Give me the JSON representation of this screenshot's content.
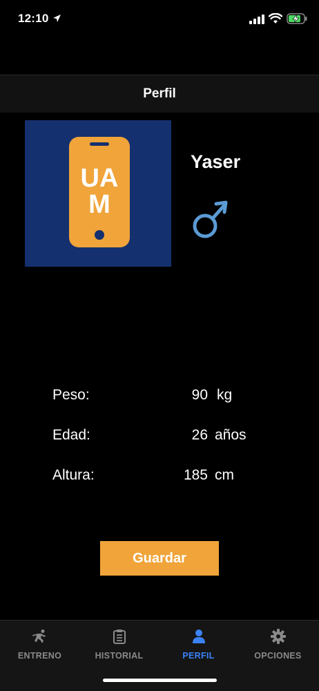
{
  "status_bar": {
    "time": "12:10"
  },
  "nav": {
    "title": "Perfil"
  },
  "profile": {
    "logo_text_top": "UA",
    "logo_text_bottom": "M",
    "name": "Yaser",
    "gender_symbol": "♂"
  },
  "stats": [
    {
      "label": "Peso:",
      "value": "90",
      "unit": "kg"
    },
    {
      "label": "Edad:",
      "value": "26",
      "unit": "años"
    },
    {
      "label": "Altura:",
      "value": "185",
      "unit": "cm"
    }
  ],
  "save_label": "Guardar",
  "tabs": [
    {
      "label": "ENTRENO",
      "icon": "runner-icon"
    },
    {
      "label": "HISTORIAL",
      "icon": "clipboard-icon"
    },
    {
      "label": "PERFIL",
      "icon": "person-icon",
      "active": true
    },
    {
      "label": "OPCIONES",
      "icon": "gear-icon"
    }
  ],
  "colors": {
    "accent": "#f0a43a",
    "active_tab": "#3b82f6",
    "logo_bg": "#15306e",
    "gender": "#5b9bd5"
  }
}
